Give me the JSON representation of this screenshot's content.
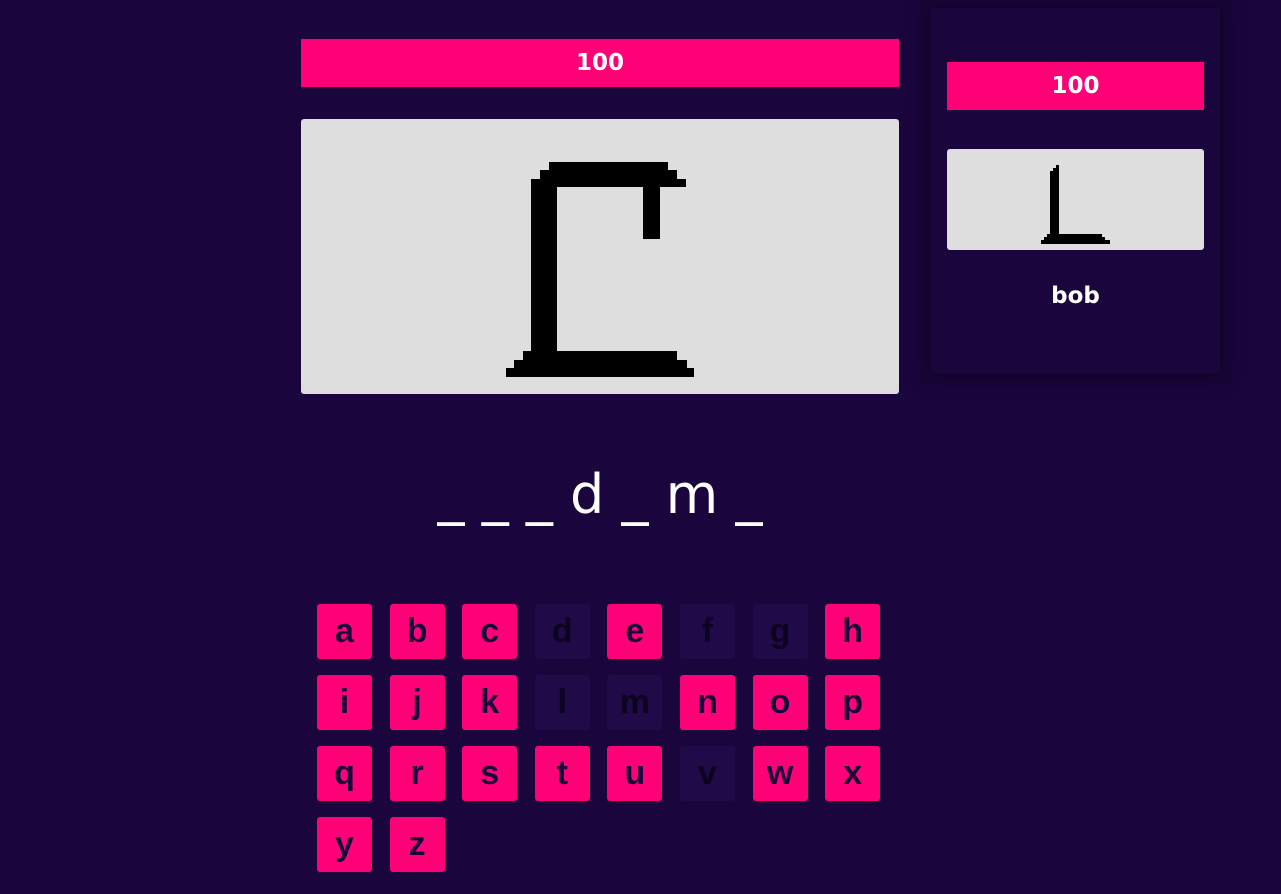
{
  "player": {
    "score": "100"
  },
  "word": {
    "letters": [
      "_",
      "_",
      "_",
      "d",
      "_",
      "m",
      "_"
    ]
  },
  "opponent": {
    "score": "100",
    "name": "bob"
  },
  "keyboard": {
    "keys": [
      {
        "letter": "a",
        "used": false
      },
      {
        "letter": "b",
        "used": false
      },
      {
        "letter": "c",
        "used": false
      },
      {
        "letter": "d",
        "used": true
      },
      {
        "letter": "e",
        "used": false
      },
      {
        "letter": "f",
        "used": true
      },
      {
        "letter": "g",
        "used": true
      },
      {
        "letter": "h",
        "used": false
      },
      {
        "letter": "i",
        "used": false
      },
      {
        "letter": "j",
        "used": false
      },
      {
        "letter": "k",
        "used": false
      },
      {
        "letter": "l",
        "used": true
      },
      {
        "letter": "m",
        "used": true
      },
      {
        "letter": "n",
        "used": false
      },
      {
        "letter": "o",
        "used": false
      },
      {
        "letter": "p",
        "used": false
      },
      {
        "letter": "q",
        "used": false
      },
      {
        "letter": "r",
        "used": false
      },
      {
        "letter": "s",
        "used": false
      },
      {
        "letter": "t",
        "used": false
      },
      {
        "letter": "u",
        "used": false
      },
      {
        "letter": "v",
        "used": true
      },
      {
        "letter": "w",
        "used": false
      },
      {
        "letter": "x",
        "used": false
      },
      {
        "letter": "y",
        "used": false
      },
      {
        "letter": "z",
        "used": false
      }
    ]
  },
  "colors": {
    "background": "#1a053d",
    "accent": "#ff0077",
    "panel": "#dedede",
    "used_key": "#200a47"
  }
}
